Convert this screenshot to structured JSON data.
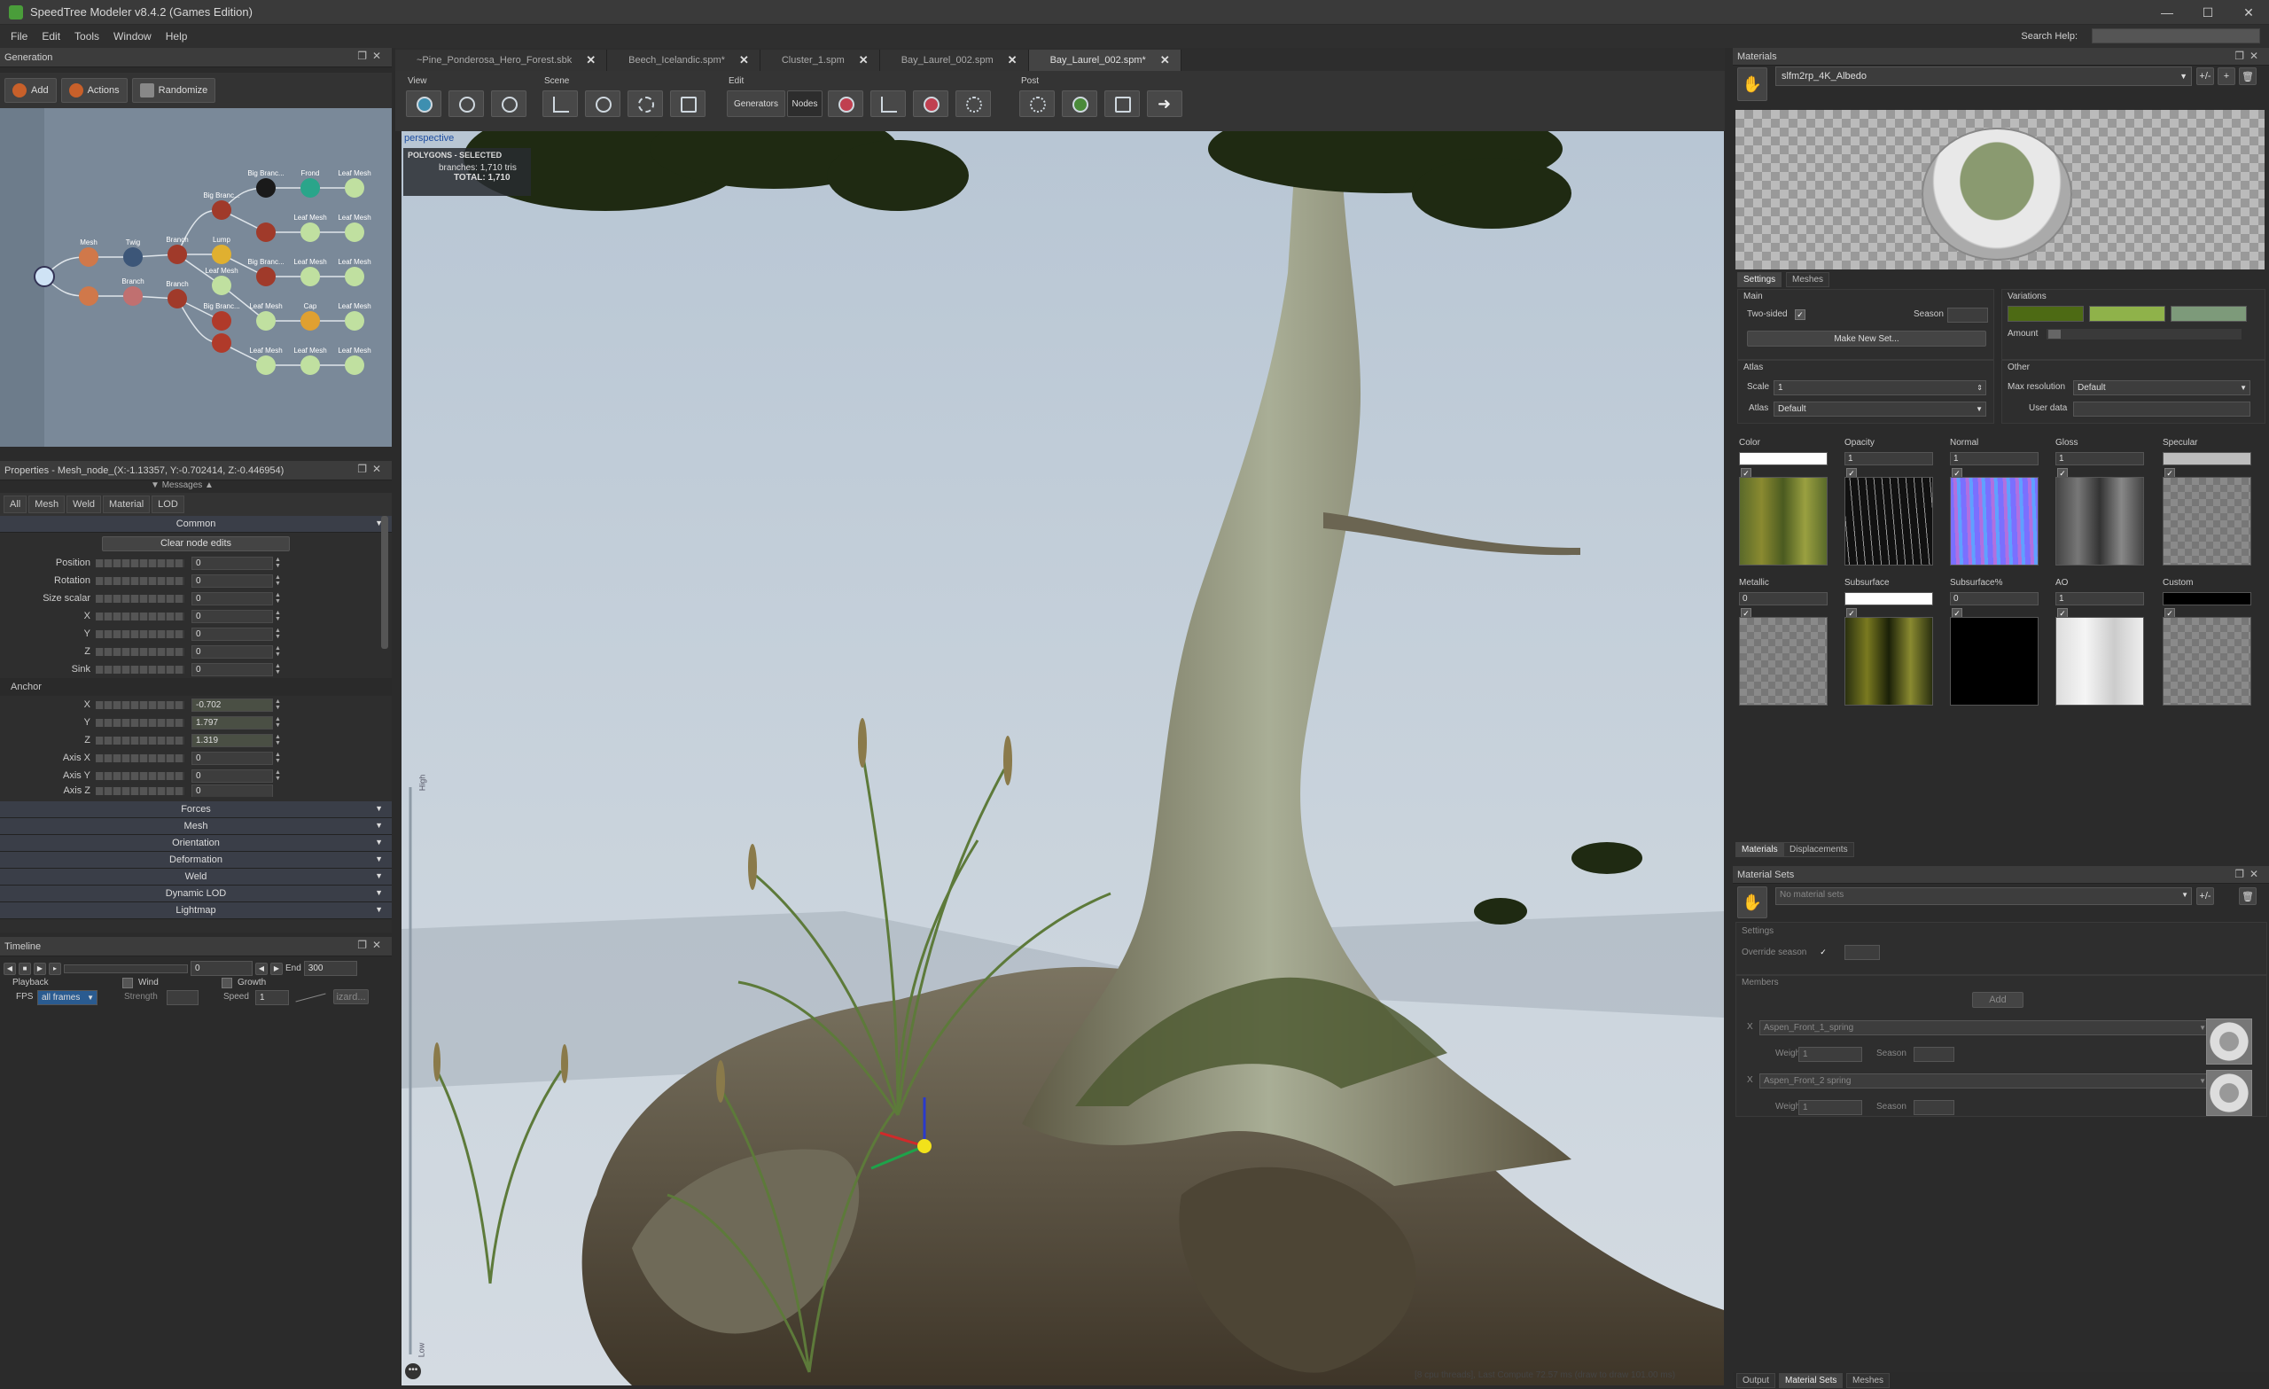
{
  "window": {
    "title": "SpeedTree Modeler v8.4.2 (Games Edition)",
    "controls": [
      "—",
      "☐",
      "✕"
    ]
  },
  "menu": [
    "File",
    "Edit",
    "Tools",
    "Window",
    "Help"
  ],
  "search_help": {
    "label": "Search Help:"
  },
  "generation": {
    "title": "Generation",
    "add": "Add",
    "actions": "Actions",
    "randomize": "Randomize",
    "nodes": [
      "Big Branc...",
      "Frond",
      "Leaf Mesh",
      "Big Branc...",
      "Leaf Mesh",
      "Leaf Mesh",
      "Mesh",
      "Branch",
      "Branch",
      "Lump",
      "Big Branc...",
      "Leaf Mesh",
      "Leaf Mesh",
      "Twig",
      "Branch",
      "Leaf Mesh",
      "Leaf Mesh",
      "Cap",
      "Leaf Mesh",
      "Big Branc...",
      "Leaf Mesh",
      "Leaf Mesh",
      "Leaf Mesh"
    ]
  },
  "properties": {
    "title": "Properties - Mesh_node_(X:-1.13357, Y:-0.702414, Z:-0.446954)",
    "tabs": [
      "All",
      "Mesh",
      "Weld",
      "Material",
      "LOD"
    ],
    "messages": "Messages",
    "common": "Common",
    "clear_button": "Clear node edits",
    "rows": [
      {
        "label": "Position",
        "value": "0"
      },
      {
        "label": "Rotation",
        "value": "0"
      },
      {
        "label": "Size scalar",
        "value": "0"
      },
      {
        "label": "X",
        "value": "0"
      },
      {
        "label": "Y",
        "value": "0"
      },
      {
        "label": "Z",
        "value": "0"
      },
      {
        "label": "Sink",
        "value": "0"
      }
    ],
    "anchor_label": "Anchor",
    "anchor_rows": [
      {
        "label": "X",
        "value": "-0.702"
      },
      {
        "label": "Y",
        "value": "1.797"
      },
      {
        "label": "Z",
        "value": "1.319"
      },
      {
        "label": "Axis X",
        "value": "0"
      },
      {
        "label": "Axis Y",
        "value": "0"
      },
      {
        "label": "Axis Z",
        "value": "0"
      }
    ],
    "sections": [
      "Forces",
      "Mesh",
      "Orientation",
      "Deformation",
      "Weld",
      "Dynamic LOD",
      "Lightmap"
    ]
  },
  "timeline": {
    "title": "Timeline",
    "frame": "0",
    "end_label": "End",
    "end": "300",
    "playback": "Playback",
    "fps_label": "FPS",
    "fps": "all frames",
    "wind": "Wind",
    "strength": "Strength",
    "growth": "Growth",
    "speed_label": "Speed",
    "speed": "1",
    "wizard": "izard..."
  },
  "doc_tabs": [
    {
      "label": "~Pine_Ponderosa_Hero_Forest.sbk",
      "active": false
    },
    {
      "label": "Beech_Icelandic.spm*",
      "active": false
    },
    {
      "label": "Cluster_1.spm",
      "active": false
    },
    {
      "label": "Bay_Laurel_002.spm",
      "active": false
    },
    {
      "label": "Bay_Laurel_002.spm*",
      "active": true
    }
  ],
  "toolbar": {
    "view": "View",
    "scene": "Scene",
    "edit": "Edit",
    "post": "Post",
    "generators": "Generators",
    "nodes": "Nodes"
  },
  "viewport": {
    "mode": "perspective",
    "info_title": "POLYGONS - SELECTED",
    "branches_label": "branches:",
    "branches": "1,710 tris",
    "total_label": "TOTAL:",
    "total": "1,710",
    "status": "[8 cpu threads], Last Compute 72.57 ms (draw to draw 101.00 ms)",
    "ruler_top": "High",
    "ruler_bottom": "Low"
  },
  "materials": {
    "title": "Materials",
    "selected": "slfm2rp_4K_Albedo",
    "tabs": [
      "Settings",
      "Meshes"
    ],
    "main": "Main",
    "two_sided": "Two-sided",
    "season": "Season",
    "make_new_set": "Make New Set...",
    "variations": "Variations",
    "amount": "Amount",
    "variation_colors": [
      "#4d6a14",
      "#8fb24a",
      "#7d9a7a"
    ],
    "atlas": "Atlas",
    "scale_label": "Scale",
    "scale": "1",
    "atlas_label": "Atlas",
    "atlas_value": "Default",
    "other": "Other",
    "max_res_label": "Max resolution",
    "max_res": "Default",
    "user_data": "User data",
    "textures_row1": [
      {
        "label": "Color",
        "value": "",
        "swatch": "#ffffff"
      },
      {
        "label": "Opacity",
        "value": "1"
      },
      {
        "label": "Normal",
        "value": "1"
      },
      {
        "label": "Gloss",
        "value": "1"
      },
      {
        "label": "Specular",
        "value": "",
        "swatch": "#bdbdbd"
      }
    ],
    "textures_row2": [
      {
        "label": "Metallic",
        "value": "0"
      },
      {
        "label": "Subsurface",
        "value": "",
        "swatch": "#ffffff"
      },
      {
        "label": "Subsurface%",
        "value": "0"
      },
      {
        "label": "AO",
        "value": "1"
      },
      {
        "label": "Custom",
        "value": "",
        "swatch": "#000000"
      }
    ],
    "bottom_tabs": [
      "Materials",
      "Displacements"
    ]
  },
  "material_sets": {
    "title": "Material Sets",
    "selected": "No material sets",
    "settings": "Settings",
    "override_season": "Override season",
    "members": "Members",
    "add": "Add",
    "items": [
      {
        "name": "Aspen_Front_1_spring",
        "weight": "1",
        "season_label": "Season"
      },
      {
        "name": "Aspen_Front_2 spring",
        "weight": "1",
        "season_label": "Season"
      }
    ],
    "weight_label": "Weight",
    "bottom_tabs": [
      "Output",
      "Material Sets",
      "Meshes"
    ]
  }
}
